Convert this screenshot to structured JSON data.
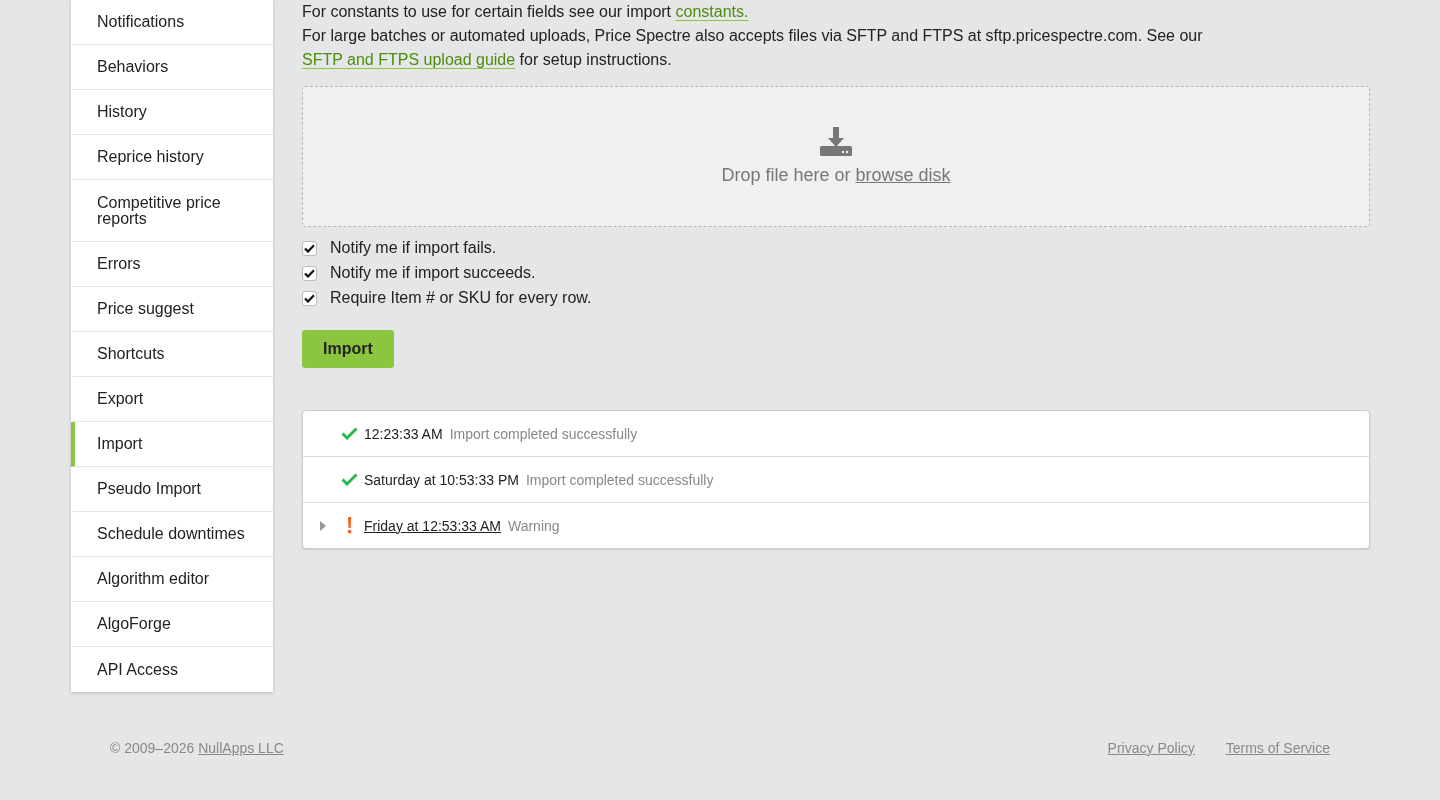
{
  "sidebar": {
    "items": [
      {
        "label": "Notifications",
        "selected": false
      },
      {
        "label": "Behaviors",
        "selected": false
      },
      {
        "label": "History",
        "selected": false
      },
      {
        "label": "Reprice history",
        "selected": false
      },
      {
        "label": "Competitive price reports",
        "selected": false
      },
      {
        "label": "Errors",
        "selected": false
      },
      {
        "label": "Price suggest",
        "selected": false
      },
      {
        "label": "Shortcuts",
        "selected": false
      },
      {
        "label": "Export",
        "selected": false
      },
      {
        "label": "Import",
        "selected": true
      },
      {
        "label": "Pseudo Import",
        "selected": false
      },
      {
        "label": "Schedule downtimes",
        "selected": false
      },
      {
        "label": "Algorithm editor",
        "selected": false
      },
      {
        "label": "AlgoForge",
        "selected": false
      },
      {
        "label": "API Access",
        "selected": false
      }
    ]
  },
  "intro": [
    [
      {
        "kind": "text",
        "text": "For constants to use for certain fields see our import "
      },
      {
        "kind": "link",
        "text": "constants."
      }
    ],
    [
      {
        "kind": "text",
        "text": "For large batches or automated uploads, Price Spectre also accepts files via SFTP and FTPS at sftp.pricespectre.com. See our "
      },
      {
        "kind": "link",
        "text": "SFTP and FTPS upload guide"
      },
      {
        "kind": "text",
        "text": " for setup instructions."
      }
    ]
  ],
  "dropzone": {
    "text": "Drop file here or ",
    "link": "browse disk"
  },
  "options": [
    {
      "label": "Notify me if import fails.",
      "checked": true
    },
    {
      "label": "Notify me if import succeeds.",
      "checked": true
    },
    {
      "label": "Require Item # or SKU for every row.",
      "checked": true
    }
  ],
  "import_button": "Import",
  "log": [
    {
      "kind": "success",
      "time": "12:23:33 AM",
      "message": "Import completed successfully"
    },
    {
      "kind": "success",
      "time": "Saturday at 10:53:33 PM",
      "message": "Import completed successfully"
    },
    {
      "kind": "warning",
      "time": "Friday at 12:53:33 AM",
      "message": "Warning"
    }
  ],
  "footer": {
    "copyright": "© 2009–2026 ",
    "company": "NullApps LLC",
    "links": [
      "Privacy Policy",
      "Terms of Service"
    ]
  }
}
